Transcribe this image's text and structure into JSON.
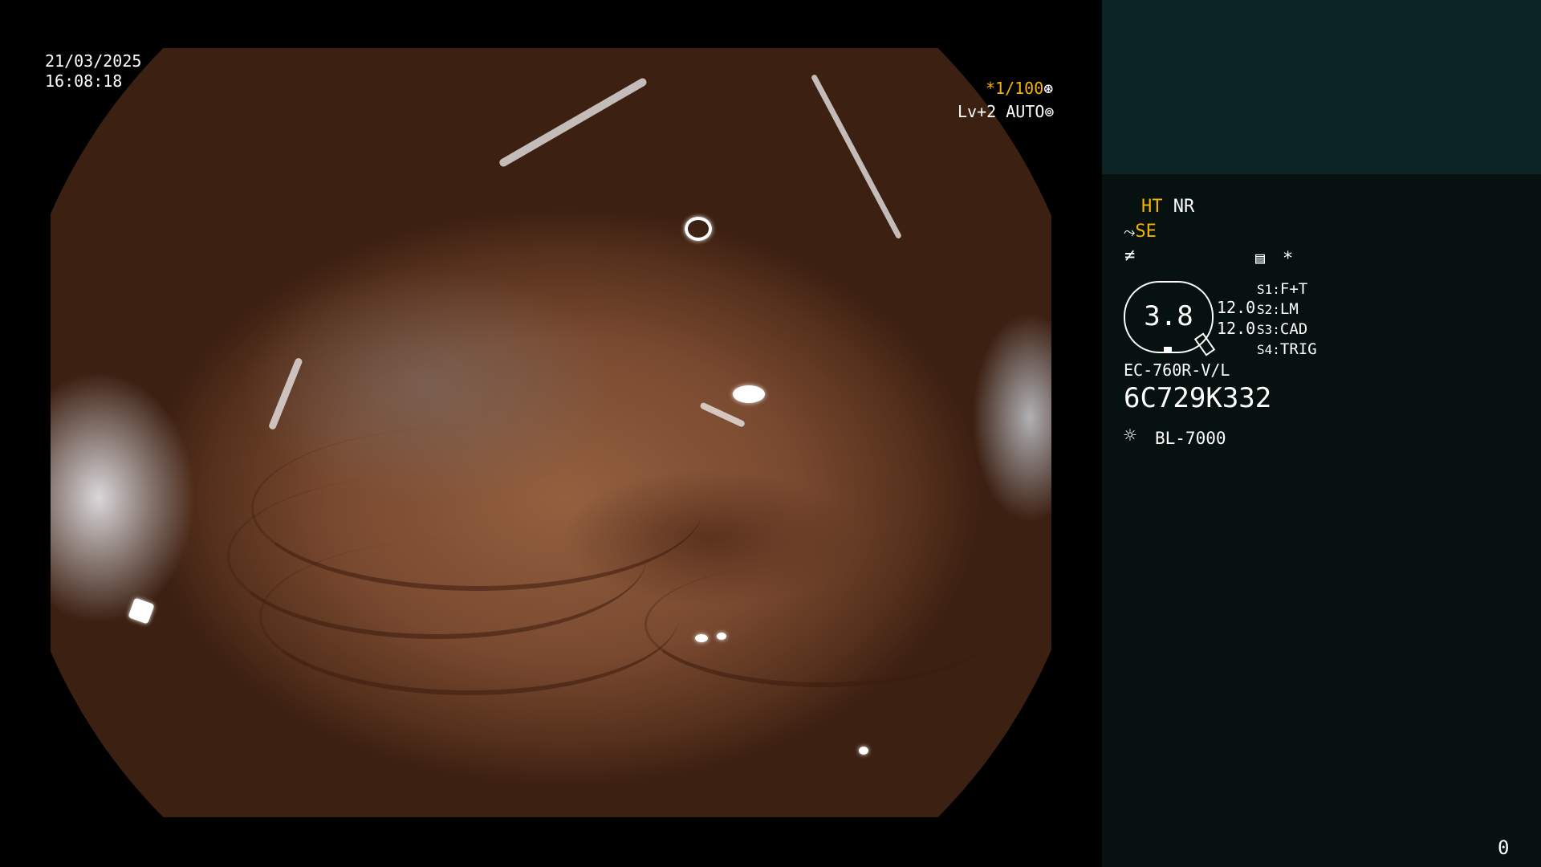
{
  "overlay": {
    "date": "21/03/2025",
    "time": "16:08:18",
    "shutter": "*1/100",
    "shutter_icon": "iris-icon",
    "level": "Lv+2 AUTO",
    "level_icon": "auto-iris-icon"
  },
  "panel": {
    "ht": "HT",
    "nr": "NR",
    "se": "SE",
    "se_icon": "enhancement-icon",
    "contrast_icon": "contrast-icon",
    "menu_icon": "list-icon",
    "menu_symbol": "*",
    "zoom": "3.8",
    "values": [
      "12.0",
      "12.0"
    ],
    "switches": [
      {
        "key": "S1",
        "value": "F+T"
      },
      {
        "key": "S2",
        "value": "LM"
      },
      {
        "key": "S3",
        "value": "CAD"
      },
      {
        "key": "S4",
        "value": "TRIG"
      }
    ],
    "scope_model": "EC-760R-V/L",
    "serial": "6C729K332",
    "light_icon": "light-source-icon",
    "light_source": "BL-7000",
    "page_counter": "0"
  },
  "colors": {
    "accent": "#f5b400",
    "panel_bg": "#071110",
    "panel_top": "#0c2424"
  }
}
